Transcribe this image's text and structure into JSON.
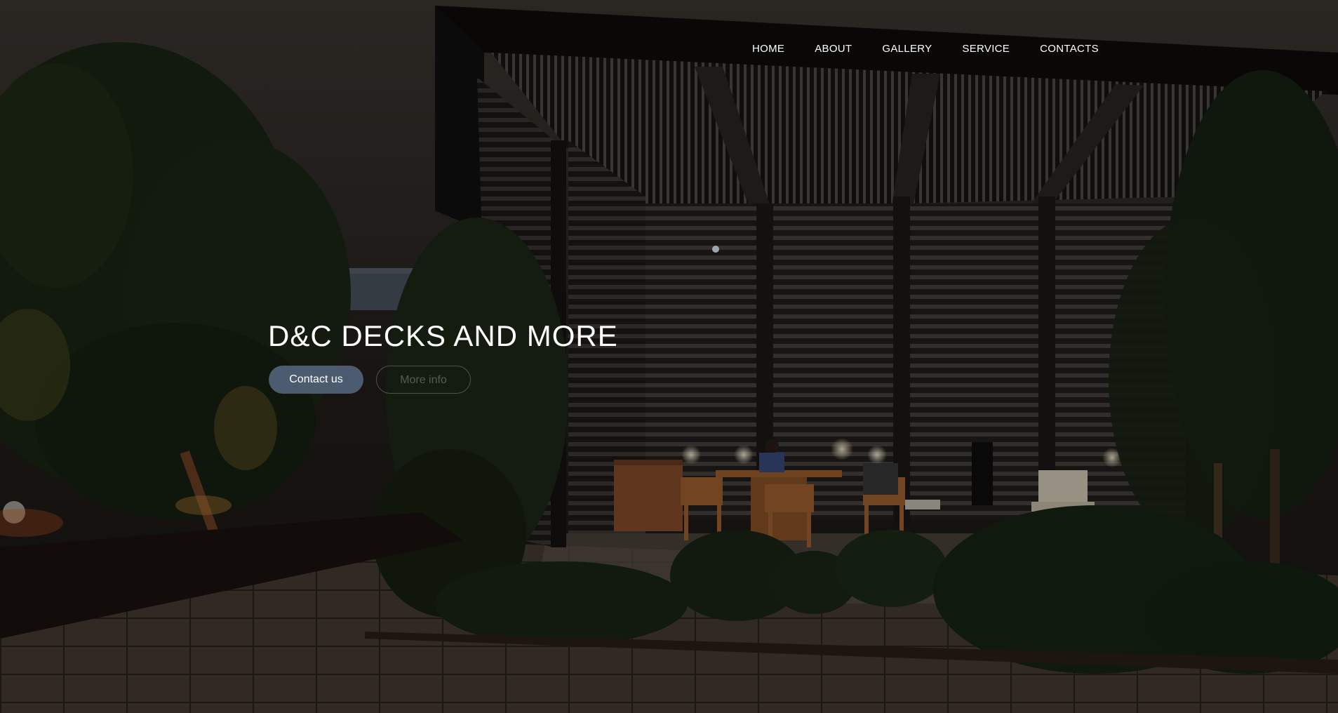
{
  "nav": {
    "items": [
      {
        "label": "HOME"
      },
      {
        "label": "ABOUT"
      },
      {
        "label": "GALLERY"
      },
      {
        "label": "SERVICE"
      },
      {
        "label": "CONTACTS"
      }
    ]
  },
  "hero": {
    "title": "D&C DECKS AND MORE",
    "primary_button": "Contact us",
    "secondary_button": "More info"
  },
  "colors": {
    "primary_button_bg": "#4c5b70",
    "text": "#ffffff"
  }
}
